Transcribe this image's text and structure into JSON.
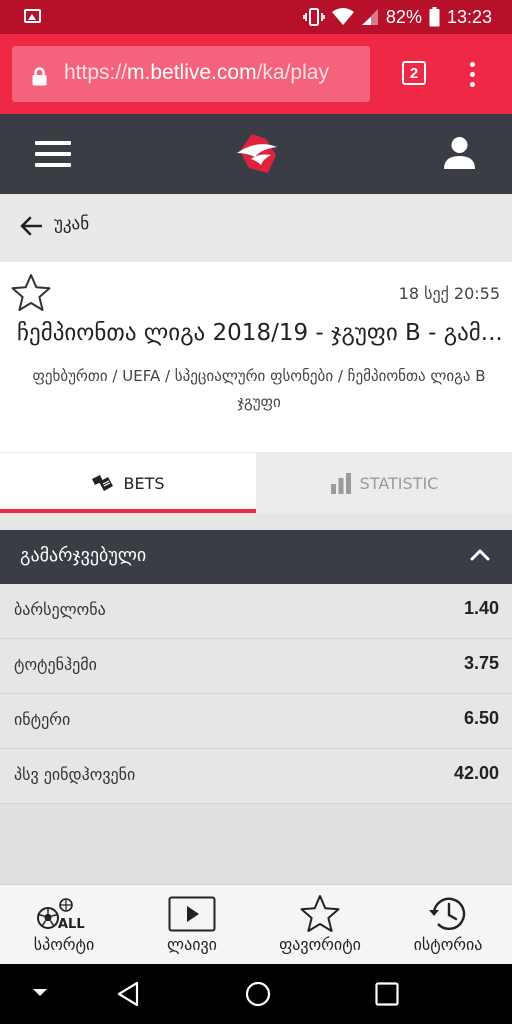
{
  "status_bar": {
    "battery": "82%",
    "time": "13:23"
  },
  "browser": {
    "url_scheme": "https://",
    "url_host": "m.betlive.com",
    "url_path": "/ka/play",
    "tab_count": "2"
  },
  "back": {
    "label": "უკან"
  },
  "event": {
    "date": "18 სექ 20:55",
    "title": "ჩემპიონთა ლიგა 2018/19 - ჯგუფი B - გამ...",
    "breadcrumb": "ფეხბურთი / UEFA / სპეციალური ფსონები / ჩემპიონთა ლიგა B ჯგუფი"
  },
  "tabs": {
    "bets": "BETS",
    "statistic": "STATISTIC"
  },
  "market": {
    "name": "გამარჯვებული",
    "selections": [
      {
        "label": "ბარსელონა",
        "odd": "1.40"
      },
      {
        "label": "ტოტენჰემი",
        "odd": "3.75"
      },
      {
        "label": "ინტერი",
        "odd": "6.50"
      },
      {
        "label": "პსვ ეინდჰოვენი",
        "odd": "42.00"
      }
    ]
  },
  "bottom_nav": {
    "sport_badge": "ALL",
    "sport": "სპორტი",
    "live": "ლაივი",
    "favorites": "ფავორიტი",
    "history": "ისტორია"
  },
  "colors": {
    "brand_red": "#ef2846",
    "dark_bar": "#3a3d44",
    "status_bar": "#b6102a"
  }
}
